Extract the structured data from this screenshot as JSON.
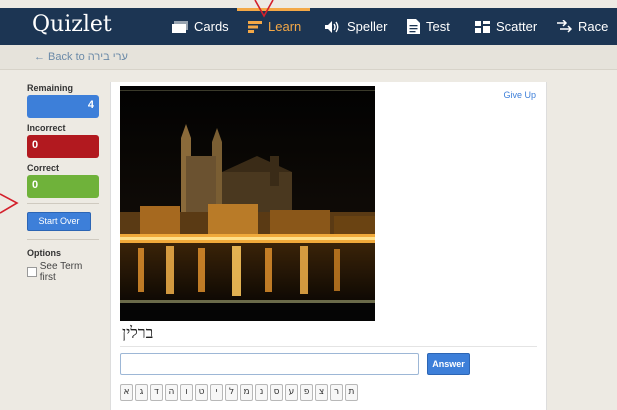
{
  "app": {
    "logo": "Quizlet"
  },
  "nav": [
    {
      "label": "Cards",
      "icon": "cards-icon",
      "active": false
    },
    {
      "label": "Learn",
      "icon": "learn-icon",
      "active": true
    },
    {
      "label": "Speller",
      "icon": "speaker-icon",
      "active": false
    },
    {
      "label": "Test",
      "icon": "document-icon",
      "active": false
    },
    {
      "label": "Scatter",
      "icon": "grid-icon",
      "active": false
    },
    {
      "label": "Race",
      "icon": "race-icon",
      "active": false
    }
  ],
  "breadcrumb": {
    "prefix": "← Back to",
    "set_name": "ערי בירה"
  },
  "stats": {
    "remaining_label": "Remaining",
    "remaining": "4",
    "incorrect_label": "Incorrect",
    "incorrect": "0",
    "correct_label": "Correct",
    "correct": "0"
  },
  "actions": {
    "start_over": "Start Over"
  },
  "options": {
    "title": "Options",
    "see_term_first": "See Term first"
  },
  "card": {
    "give_up": "Give Up",
    "term": "ברלין",
    "answer_value": "",
    "answer_button": "Answer"
  },
  "letters": [
    "ת",
    "ר",
    "צ",
    "פ",
    "ע",
    "ס",
    "נ",
    "מ",
    "ל",
    "י",
    "ט",
    "ו",
    "ה",
    "ד",
    "ג",
    "א"
  ],
  "colors": {
    "navbar": "#1c3553",
    "accent": "#f3a847",
    "blue": "#3d7fd9",
    "red": "#b2191f",
    "green": "#6fb23a",
    "annotation": "#d4202c"
  }
}
